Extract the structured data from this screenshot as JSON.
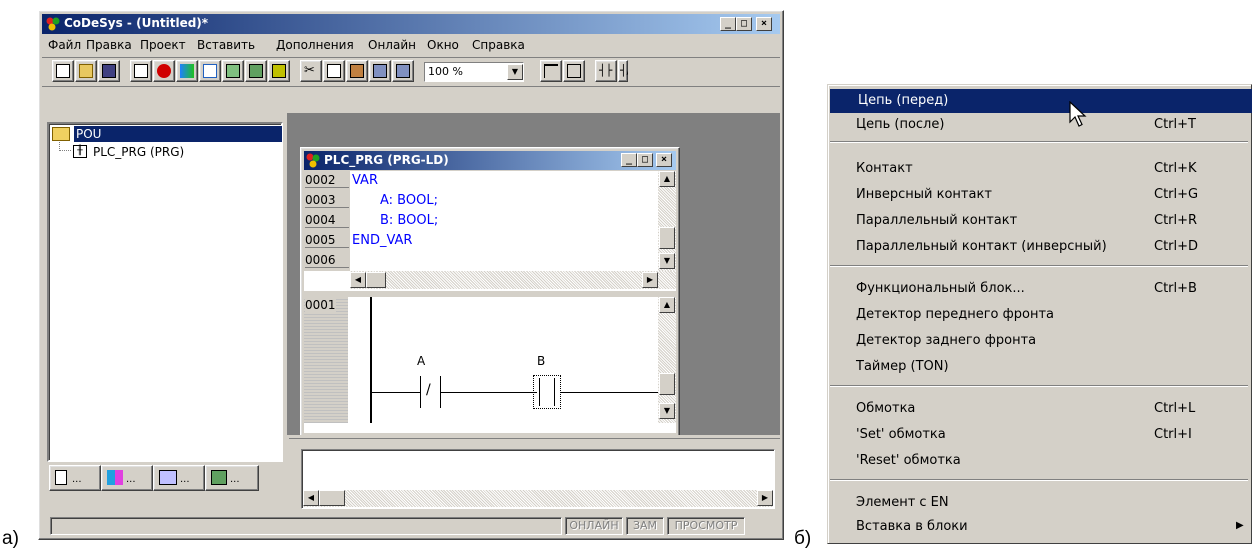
{
  "labels": {
    "left": "а)",
    "right": "б)"
  },
  "app": {
    "title": "CoDeSys - (Untitled)*",
    "menu": [
      "Файл",
      "Правка",
      "Проект",
      "Вставить",
      "Дополнения",
      "Онлайн",
      "Окно",
      "Справка"
    ],
    "zoom": "100 %"
  },
  "tree": {
    "root": "POU",
    "child": "PLC_PRG (PRG)"
  },
  "editor": {
    "title": "PLC_PRG (PRG-LD)",
    "lines": [
      {
        "num": "0002",
        "text": "VAR"
      },
      {
        "num": "0003",
        "text": "A: BOOL;"
      },
      {
        "num": "0004",
        "text": "B: BOOL;"
      },
      {
        "num": "0005",
        "text": "END_VAR"
      },
      {
        "num": "0006",
        "text": ""
      }
    ],
    "network": "0001",
    "contact_a": "A",
    "contact_b": "B"
  },
  "status": {
    "online": "ОНЛАЙН",
    "rep": "ЗАМ",
    "view": "ПРОСМОТР"
  },
  "context_menu": {
    "items": [
      {
        "label": "Цепь (перед)",
        "key": ""
      },
      {
        "label": "Цепь (после)",
        "key": "Ctrl+T"
      },
      {
        "label": "Контакт",
        "key": "Ctrl+K"
      },
      {
        "label": "Инверсный контакт",
        "key": "Ctrl+G"
      },
      {
        "label": "Параллельный контакт",
        "key": "Ctrl+R"
      },
      {
        "label": "Параллельный контакт (инверсный)",
        "key": "Ctrl+D"
      },
      {
        "label": "Функциональный блок...",
        "key": "Ctrl+B"
      },
      {
        "label": "Детектор переднего фронта",
        "key": ""
      },
      {
        "label": "Детектор заднего фронта",
        "key": ""
      },
      {
        "label": "Таймер (TON)",
        "key": ""
      },
      {
        "label": "Обмотка",
        "key": "Ctrl+L"
      },
      {
        "label": "'Set' обмотка",
        "key": "Ctrl+I"
      },
      {
        "label": "'Reset' обмотка",
        "key": ""
      },
      {
        "label": "Элемент с EN",
        "key": ""
      },
      {
        "label": "Вставка в блоки",
        "key": ""
      }
    ]
  },
  "colors": {
    "titlebar": "#0a246a",
    "titlebar_end": "#a6caf0",
    "face": "#d4d0c8",
    "desktop": "#808080",
    "keyword": "#0000ff",
    "highlight": "#0a246a"
  }
}
